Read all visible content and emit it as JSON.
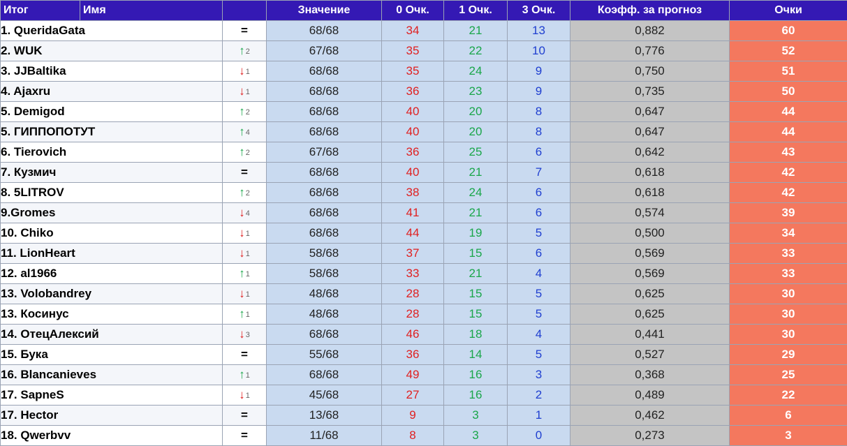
{
  "headers": {
    "place": "Итог",
    "name": "Имя",
    "trend": "",
    "value": "Значение",
    "zero": "0 Очк.",
    "one": "1 Очк.",
    "three": "3 Очк.",
    "coef": "Коэфф. за прогноз",
    "points": "Очки"
  },
  "colors": {
    "header_bg": "#3419b4",
    "value_bg": "#c9daf0",
    "coef_bg": "#c4c4c4",
    "points_bg": "#f4785e",
    "zero_text": "#e02020",
    "one_text": "#1aa64a",
    "three_text": "#1f3fd0"
  },
  "rows": [
    {
      "name": "1. QueridaGata",
      "trend": "eq",
      "change": "",
      "value": "68/68",
      "zero": "34",
      "one": "21",
      "three": "13",
      "coef": "0,882",
      "points": "60"
    },
    {
      "name": "2. WUK",
      "trend": "up",
      "change": "2",
      "value": "67/68",
      "zero": "35",
      "one": "22",
      "three": "10",
      "coef": "0,776",
      "points": "52"
    },
    {
      "name": "3. JJBaltika",
      "trend": "down",
      "change": "1",
      "value": "68/68",
      "zero": "35",
      "one": "24",
      "three": "9",
      "coef": "0,750",
      "points": "51"
    },
    {
      "name": "4. Ajaxru",
      "trend": "down",
      "change": "1",
      "value": "68/68",
      "zero": "36",
      "one": "23",
      "three": "9",
      "coef": "0,735",
      "points": "50"
    },
    {
      "name": "5. Demigod",
      "trend": "up",
      "change": "2",
      "value": "68/68",
      "zero": "40",
      "one": "20",
      "three": "8",
      "coef": "0,647",
      "points": "44"
    },
    {
      "name": "5. ГИППОПОТУТ",
      "trend": "up",
      "change": "4",
      "value": "68/68",
      "zero": "40",
      "one": "20",
      "three": "8",
      "coef": "0,647",
      "points": "44"
    },
    {
      "name": "6. Tierovich",
      "trend": "up",
      "change": "2",
      "value": "67/68",
      "zero": "36",
      "one": "25",
      "three": "6",
      "coef": "0,642",
      "points": "43"
    },
    {
      "name": "7. Кузмич",
      "trend": "eq",
      "change": "",
      "value": "68/68",
      "zero": "40",
      "one": "21",
      "three": "7",
      "coef": "0,618",
      "points": "42"
    },
    {
      "name": "8. 5LITROV",
      "trend": "up",
      "change": "2",
      "value": "68/68",
      "zero": "38",
      "one": "24",
      "three": "6",
      "coef": "0,618",
      "points": "42"
    },
    {
      "name": "9.Gromes",
      "trend": "down",
      "change": "4",
      "value": "68/68",
      "zero": "41",
      "one": "21",
      "three": "6",
      "coef": "0,574",
      "points": "39"
    },
    {
      "name": "10. Chiko",
      "trend": "down",
      "change": "1",
      "value": "68/68",
      "zero": "44",
      "one": "19",
      "three": "5",
      "coef": "0,500",
      "points": "34"
    },
    {
      "name": "11. LionHeart",
      "trend": "down",
      "change": "1",
      "value": "58/68",
      "zero": "37",
      "one": "15",
      "three": "6",
      "coef": "0,569",
      "points": "33"
    },
    {
      "name": "12. al1966",
      "trend": "up",
      "change": "1",
      "value": "58/68",
      "zero": "33",
      "one": "21",
      "three": "4",
      "coef": "0,569",
      "points": "33"
    },
    {
      "name": "13. Volobandrey",
      "trend": "down",
      "change": "1",
      "value": "48/68",
      "zero": "28",
      "one": "15",
      "three": "5",
      "coef": "0,625",
      "points": "30"
    },
    {
      "name": "13. Косинус",
      "trend": "up",
      "change": "1",
      "value": "48/68",
      "zero": "28",
      "one": "15",
      "three": "5",
      "coef": "0,625",
      "points": "30"
    },
    {
      "name": "14. ОтецАлексий",
      "trend": "down",
      "change": "3",
      "value": "68/68",
      "zero": "46",
      "one": "18",
      "three": "4",
      "coef": "0,441",
      "points": "30"
    },
    {
      "name": "15. Бука",
      "trend": "eq",
      "change": "",
      "value": "55/68",
      "zero": "36",
      "one": "14",
      "three": "5",
      "coef": "0,527",
      "points": "29"
    },
    {
      "name": "16. Blancanieves",
      "trend": "up",
      "change": "1",
      "value": "68/68",
      "zero": "49",
      "one": "16",
      "three": "3",
      "coef": "0,368",
      "points": "25"
    },
    {
      "name": "17. SapneS",
      "trend": "down",
      "change": "1",
      "value": "45/68",
      "zero": "27",
      "one": "16",
      "three": "2",
      "coef": "0,489",
      "points": "22"
    },
    {
      "name": "17. Hector",
      "trend": "eq",
      "change": "",
      "value": "13/68",
      "zero": "9",
      "one": "3",
      "three": "1",
      "coef": "0,462",
      "points": "6"
    },
    {
      "name": "18. Qwerbvv",
      "trend": "eq",
      "change": "",
      "value": "11/68",
      "zero": "8",
      "one": "3",
      "three": "0",
      "coef": "0,273",
      "points": "3"
    }
  ]
}
